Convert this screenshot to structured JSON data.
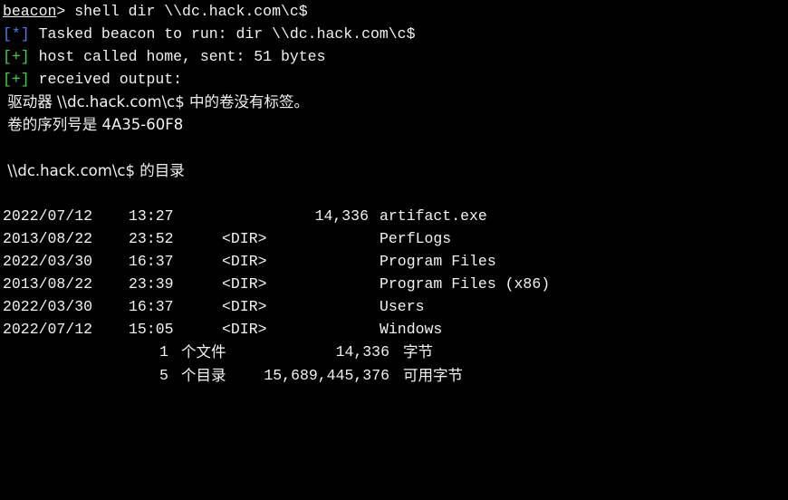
{
  "prompt": {
    "name": "beacon",
    "symbol": ">",
    "command": " shell dir \\\\dc.hack.com\\c$"
  },
  "messages": [
    {
      "tag": "[*]",
      "text": " Tasked beacon to run: dir \\\\dc.hack.com\\c$"
    },
    {
      "tag": "[+]",
      "text": " host called home, sent: 51 bytes"
    },
    {
      "tag": "[+]",
      "text": " received output:"
    }
  ],
  "output_header": [
    " 驱动器 \\\\dc.hack.com\\c$ 中的卷没有标签。",
    " 卷的序列号是 4A35-60F8",
    "",
    " \\\\dc.hack.com\\c$ 的目录",
    ""
  ],
  "entries": [
    {
      "date": "2022/07/12",
      "time": "13:27",
      "dir": "",
      "size": "14,336",
      "name": "artifact.exe"
    },
    {
      "date": "2013/08/22",
      "time": "23:52",
      "dir": "<DIR>",
      "size": "",
      "name": "PerfLogs"
    },
    {
      "date": "2022/03/30",
      "time": "16:37",
      "dir": "<DIR>",
      "size": "",
      "name": "Program Files"
    },
    {
      "date": "2013/08/22",
      "time": "23:39",
      "dir": "<DIR>",
      "size": "",
      "name": "Program Files (x86)"
    },
    {
      "date": "2022/03/30",
      "time": "16:37",
      "dir": "<DIR>",
      "size": "",
      "name": "Users"
    },
    {
      "date": "2022/07/12",
      "time": "15:05",
      "dir": "<DIR>",
      "size": "",
      "name": "Windows"
    }
  ],
  "summary": [
    {
      "count": "1",
      "label": "个文件",
      "size": "14,336",
      "unit": "字节"
    },
    {
      "count": "5",
      "label": "个目录",
      "size": "15,689,445,376",
      "unit": "可用字节"
    }
  ],
  "colors": {
    "background": "#000000",
    "text": "#f2f2f2",
    "info_tag": "#4d7ee8",
    "success_tag": "#3fd43f"
  }
}
